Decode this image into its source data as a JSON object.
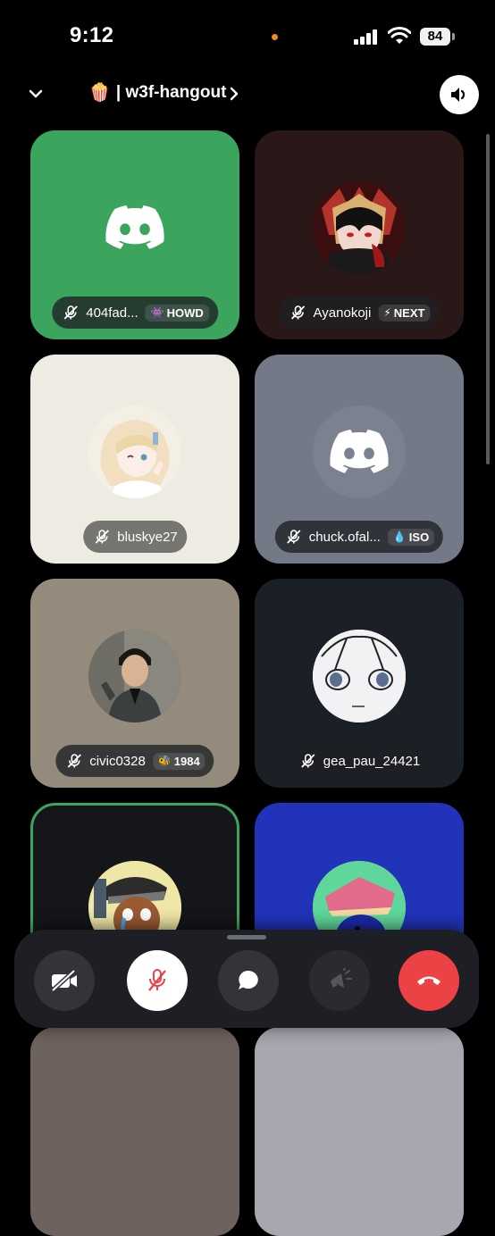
{
  "status_bar": {
    "time": "9:12",
    "battery": "84"
  },
  "header": {
    "emoji": "🍿",
    "channel_name": "| w3f-hangout"
  },
  "participants": [
    {
      "username": "404fad...",
      "tag": "HOWD",
      "tag_icon": "👾"
    },
    {
      "username": "Ayanokoji",
      "tag": "NEXT",
      "tag_icon": "⚡"
    },
    {
      "username": "bluskye27"
    },
    {
      "username": "chuck.ofal...",
      "tag": "ISO",
      "tag_icon": "💧"
    },
    {
      "username": "civic0328",
      "tag": "1984",
      "tag_icon": "🐝"
    },
    {
      "username": "gea_pau_24421"
    }
  ],
  "colors": {
    "speaking_border": "#3ba55d",
    "end_call": "#ed4245",
    "discord_green": "#3ba55d"
  },
  "call_controls": [
    "camera-off",
    "mic-muted",
    "chat",
    "soundboard",
    "end-call"
  ]
}
